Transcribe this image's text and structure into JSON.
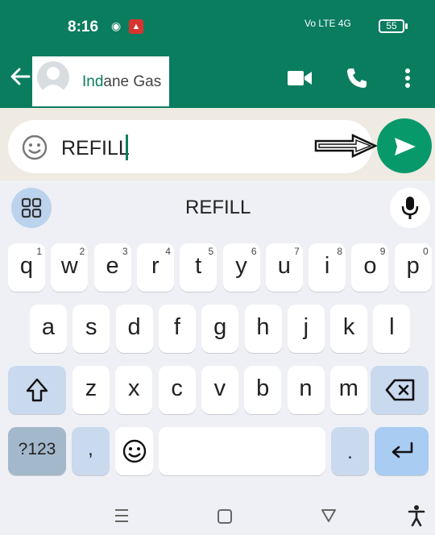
{
  "status_bar": {
    "time": "8:16",
    "signal": "Vo LTE  4G",
    "battery": "55"
  },
  "header": {
    "contact_name_prefix": "Ind",
    "contact_name_rest": "ane Gas",
    "icons": [
      "back-arrow-icon",
      "video-call-icon",
      "phone-icon",
      "more-vert-icon"
    ]
  },
  "input": {
    "value": "REFILL"
  },
  "keyboard": {
    "suggestion": "REFILL",
    "row1": [
      {
        "k": "q",
        "h": "1"
      },
      {
        "k": "w",
        "h": "2"
      },
      {
        "k": "e",
        "h": "3"
      },
      {
        "k": "r",
        "h": "4"
      },
      {
        "k": "t",
        "h": "5"
      },
      {
        "k": "y",
        "h": "6"
      },
      {
        "k": "u",
        "h": "7"
      },
      {
        "k": "i",
        "h": "8"
      },
      {
        "k": "o",
        "h": "9"
      },
      {
        "k": "p",
        "h": "0"
      }
    ],
    "row2": [
      "a",
      "s",
      "d",
      "f",
      "g",
      "h",
      "j",
      "k",
      "l"
    ],
    "row3": [
      "z",
      "x",
      "c",
      "v",
      "b",
      "n",
      "m"
    ],
    "symbols_label": "?123",
    "comma_label": ",",
    "period_label": "."
  },
  "colors": {
    "header": "#0b7d5f",
    "send_button": "#08996b",
    "special_key": "#c9d9ee"
  }
}
